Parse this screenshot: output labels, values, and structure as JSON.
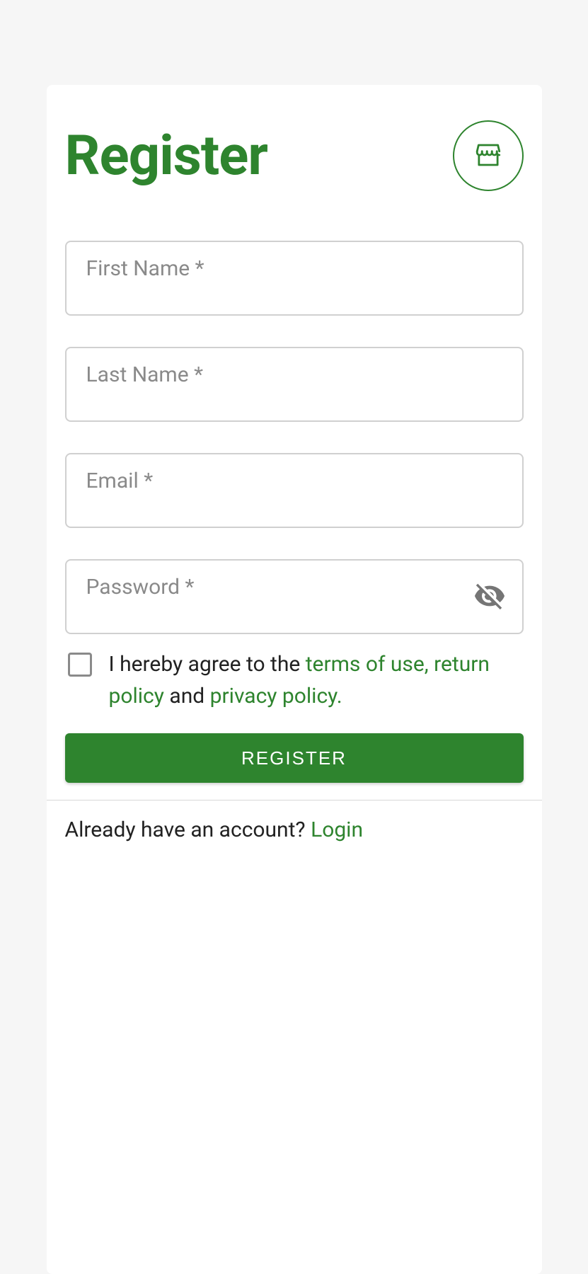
{
  "header": {
    "title": "Register"
  },
  "fields": {
    "first_name": {
      "label": "First Name *",
      "value": ""
    },
    "last_name": {
      "label": "Last Name *",
      "value": ""
    },
    "email": {
      "label": "Email *",
      "value": ""
    },
    "password": {
      "label": "Password *",
      "value": ""
    }
  },
  "agreement": {
    "prefix": "I hereby agree to the ",
    "terms": "terms of use,",
    "return": "return policy",
    "and": " and ",
    "privacy": "privacy policy."
  },
  "buttons": {
    "register": "REGISTER"
  },
  "footer": {
    "prompt": "Already have an account? ",
    "login": "Login"
  }
}
